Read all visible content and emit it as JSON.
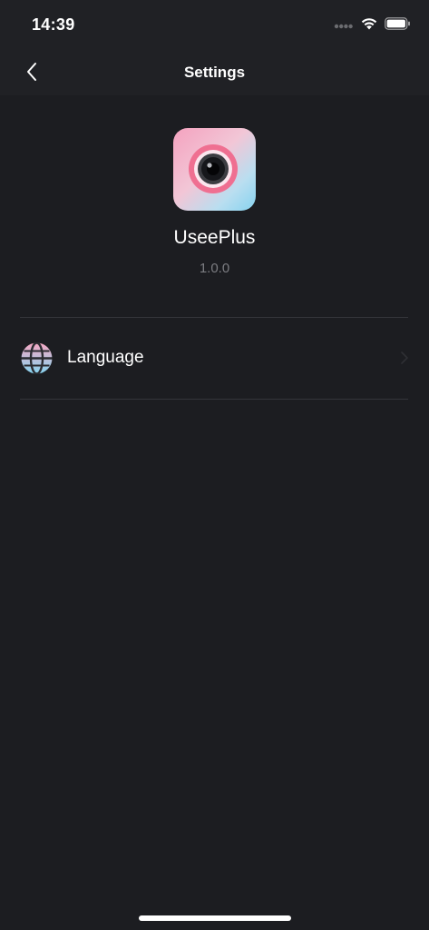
{
  "status_bar": {
    "time": "14:39",
    "signal_icon": "cellular-signal-icon",
    "wifi_icon": "wifi-icon",
    "battery_icon": "battery-icon"
  },
  "nav": {
    "back_icon": "chevron-left-icon",
    "title": "Settings"
  },
  "app": {
    "name": "UseePlus",
    "version": "1.0.0",
    "icon": "camera-lens-app-icon"
  },
  "rows": [
    {
      "label": "Language",
      "icon": "globe-icon",
      "chevron_icon": "chevron-right-icon"
    }
  ],
  "colors": {
    "background": "#1c1d21",
    "bar_background": "#202125",
    "text_primary": "#ffffff",
    "text_secondary": "#7c7d82",
    "divider": "#34353a",
    "accent_pink": "#ef6f91",
    "accent_blue": "#86d3ef"
  }
}
